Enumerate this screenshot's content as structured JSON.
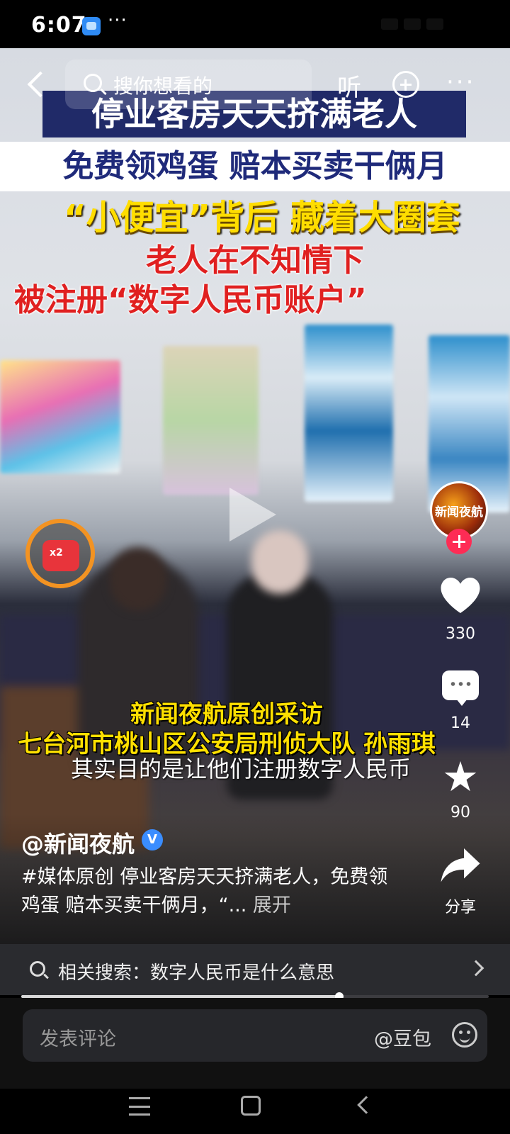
{
  "status_bar": {
    "time": "6:07",
    "more": "···"
  },
  "top_bar": {
    "search_placeholder": "搜你想看的",
    "listen_label": "听",
    "more_label": "···"
  },
  "video": {
    "headline_1": "停业客房天天挤满老人",
    "headline_2": "免费领鸡蛋 赔本买卖干俩月",
    "headline_3": "“小便宜”背后 藏着大圈套",
    "headline_4": "老人在不知情下",
    "headline_5": "被注册“数字人民币账户”",
    "caption_1": "新闻夜航原创采访",
    "caption_2": "七台河市桃山区公安局刑侦大队 孙雨琪",
    "subtitle": "其实目的是让他们注册数字人民币"
  },
  "red_packet": {
    "label": "x2"
  },
  "author": {
    "avatar_text": "新闻夜航",
    "name": "@新闻夜航",
    "verified": "V"
  },
  "rail": {
    "likes": "330",
    "comments": "14",
    "favorites": "90",
    "share_label": "分享"
  },
  "description": {
    "text": "#媒体原创 停业客房天天挤满老人，免费领鸡蛋 赔本买卖干俩月，“...",
    "expand_label": " 展开"
  },
  "related_search": {
    "text": "相关搜索：数字人民币是什么意思"
  },
  "progress": {
    "fraction": 0.68
  },
  "comment_bar": {
    "placeholder": "发表评论",
    "mention": "@豆包"
  }
}
